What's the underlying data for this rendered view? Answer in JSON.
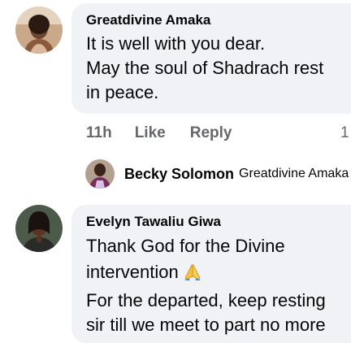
{
  "comments": [
    {
      "author": "Greatdivine Amaka",
      "lines": [
        "It is well with you dear.",
        "May the soul of Shadrach rest",
        "in peace."
      ],
      "time": "11h",
      "like_label": "Like",
      "reply_label": "Reply",
      "reaction_count": "1",
      "reply_preview": {
        "author": "Becky Solomon",
        "text": "Greatdivine Amaka"
      }
    },
    {
      "author": "Evelyn Tawaliu Giwa",
      "lines": [
        "Thank God for the Divine",
        "intervention",
        "For the departed, keep resting",
        "sir till we meet to part no more"
      ],
      "emoji": "folded-hands"
    }
  ],
  "colors": {
    "bubble_bg": "#f0f2f5",
    "secondary_text": "#65676b",
    "primary_text": "#050505"
  }
}
